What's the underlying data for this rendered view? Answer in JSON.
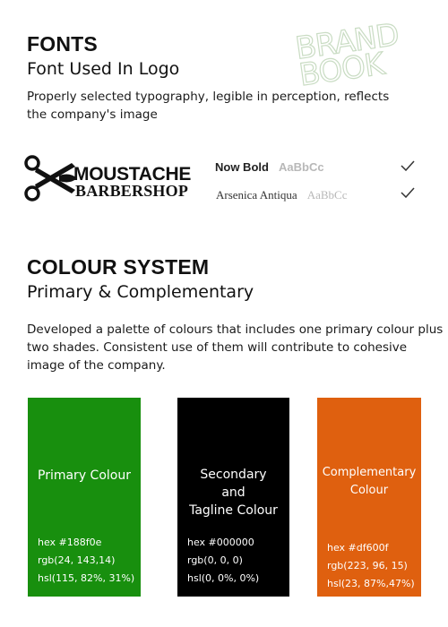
{
  "fonts_section": {
    "title": "FONTS",
    "subtitle": "Font Used In Logo",
    "description": "Properly selected typography, legible in perception, reflects the company's image"
  },
  "watermark": {
    "line1": "BRAND",
    "line2": "BOOK",
    "color": "#c9dcc3"
  },
  "logo": {
    "main": "MOUSTACHE",
    "sub": "BARBERSHOP",
    "icon": "scissors-icon"
  },
  "font_samples": [
    {
      "name": "Now Bold",
      "sample": "AaBbCc",
      "check_icon": "checkmark-icon"
    },
    {
      "name": "Arsenica Antiqua",
      "sample": "AaBbCc",
      "check_icon": "checkmark-icon"
    }
  ],
  "colour_section": {
    "title": "COLOUR SYSTEM",
    "subtitle": "Primary & Complementary",
    "description_lines": [
      "Developed a palette of colours that includes one primary colour plus",
      "two shades. Consistent use of them will contribute  to cohesive",
      "image of the company."
    ]
  },
  "swatches": [
    {
      "title_lines": [
        "Primary Colour"
      ],
      "color": "#188f0e",
      "hex": "hex  #188f0e",
      "rgb": "rgb(24, 143,14)",
      "hsl": "hsl(115, 82%, 31%)"
    },
    {
      "title_lines": [
        "Secondary",
        "and",
        "Tagline Colour"
      ],
      "color": "#000000",
      "hex": "hex  #000000",
      "rgb": "rgb(0, 0, 0)",
      "hsl": "hsl(0, 0%, 0%)"
    },
    {
      "title_lines": [
        "Complementary",
        "Colour"
      ],
      "color": "#df600f",
      "hex": "hex  #df600f",
      "rgb": "rgb(223, 96, 15)",
      "hsl": "hsl(23, 87%,47%)"
    }
  ]
}
